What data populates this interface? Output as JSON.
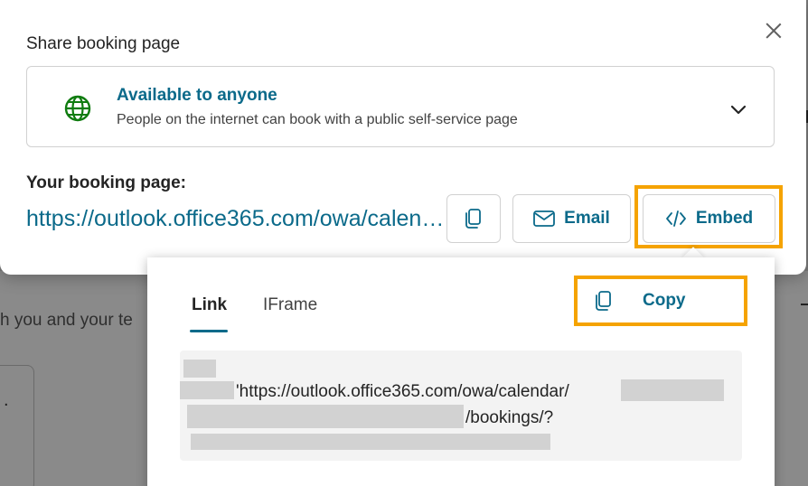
{
  "dialog": {
    "title": "Share booking page",
    "access": {
      "title": "Available to anyone",
      "description": "People on the internet can book with a public self-service page"
    },
    "page_label": "Your booking page:",
    "page_url": "https://outlook.office365.com/owa/calendar/",
    "buttons": {
      "email": "Email",
      "embed": "Embed"
    }
  },
  "popover": {
    "tabs": [
      "Link",
      "IFrame"
    ],
    "active_tab": "Link",
    "copy_label": "Copy",
    "code": {
      "url_part": "'https://outlook.office365.com/owa/calendar/",
      "path_part": "/bookings/?"
    }
  },
  "background": {
    "text_fragment": "h you and your te",
    "dot": "."
  },
  "colors": {
    "accent": "#0b6a8a",
    "globe": "#107c10",
    "highlight": "#f5a300"
  }
}
